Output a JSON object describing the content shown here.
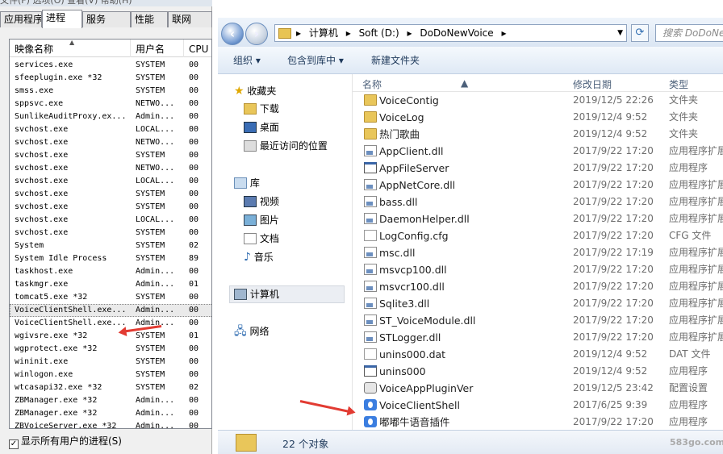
{
  "task_manager": {
    "tabs": [
      "应用程序",
      "进程",
      "服务",
      "性能",
      "联网"
    ],
    "columns": [
      "映像名称",
      "用户名",
      "CPU"
    ],
    "rows": [
      {
        "name": "services.exe",
        "user": "SYSTEM",
        "cpu": "00"
      },
      {
        "name": "sfeeplugin.exe *32",
        "user": "SYSTEM",
        "cpu": "00"
      },
      {
        "name": "smss.exe",
        "user": "SYSTEM",
        "cpu": "00"
      },
      {
        "name": "sppsvc.exe",
        "user": "NETWO...",
        "cpu": "00"
      },
      {
        "name": "SunlikeAuditProxy.ex...",
        "user": "Admin...",
        "cpu": "00"
      },
      {
        "name": "svchost.exe",
        "user": "LOCAL...",
        "cpu": "00"
      },
      {
        "name": "svchost.exe",
        "user": "NETWO...",
        "cpu": "00"
      },
      {
        "name": "svchost.exe",
        "user": "SYSTEM",
        "cpu": "00"
      },
      {
        "name": "svchost.exe",
        "user": "NETWO...",
        "cpu": "00"
      },
      {
        "name": "svchost.exe",
        "user": "LOCAL...",
        "cpu": "00"
      },
      {
        "name": "svchost.exe",
        "user": "SYSTEM",
        "cpu": "00"
      },
      {
        "name": "svchost.exe",
        "user": "SYSTEM",
        "cpu": "00"
      },
      {
        "name": "svchost.exe",
        "user": "LOCAL...",
        "cpu": "00"
      },
      {
        "name": "svchost.exe",
        "user": "SYSTEM",
        "cpu": "00"
      },
      {
        "name": "System",
        "user": "SYSTEM",
        "cpu": "02"
      },
      {
        "name": "System Idle Process",
        "user": "SYSTEM",
        "cpu": "89"
      },
      {
        "name": "taskhost.exe",
        "user": "Admin...",
        "cpu": "00"
      },
      {
        "name": "taskmgr.exe",
        "user": "Admin...",
        "cpu": "01"
      },
      {
        "name": "tomcat5.exe *32",
        "user": "SYSTEM",
        "cpu": "00"
      },
      {
        "name": "VoiceClientShell.exe...",
        "user": "Admin...",
        "cpu": "00"
      },
      {
        "name": "VoiceClientShell.exe...",
        "user": "Admin...",
        "cpu": "00"
      },
      {
        "name": "wgivsre.exe *32",
        "user": "SYSTEM",
        "cpu": "01"
      },
      {
        "name": "wgprotect.exe *32",
        "user": "SYSTEM",
        "cpu": "00"
      },
      {
        "name": "wininit.exe",
        "user": "SYSTEM",
        "cpu": "00"
      },
      {
        "name": "winlogon.exe",
        "user": "SYSTEM",
        "cpu": "00"
      },
      {
        "name": "wtcasapi32.exe *32",
        "user": "SYSTEM",
        "cpu": "02"
      },
      {
        "name": "ZBManager.exe *32",
        "user": "Admin...",
        "cpu": "00"
      },
      {
        "name": "ZBManager.exe *32",
        "user": "Admin...",
        "cpu": "00"
      },
      {
        "name": "ZBVoiceServer.exe *32",
        "user": "Admin...",
        "cpu": "00"
      }
    ],
    "show_all_label": "显示所有用户的进程(S)",
    "show_all_checked": true,
    "top_strip_text": "文件(F)  选项(O)  查看(V)  帮助(H)"
  },
  "explorer": {
    "breadcrumbs": [
      "计算机",
      "Soft (D:)",
      "DoDoNewVoice"
    ],
    "search_placeholder": "搜索 DoDoNewVoice",
    "toolbar": {
      "organize": "组织 ▾",
      "include": "包含到库中 ▾",
      "new_folder": "新建文件夹"
    },
    "tree": {
      "favorites": "收藏夹",
      "downloads": "下载",
      "desktop": "桌面",
      "recent": "最近访问的位置",
      "libraries": "库",
      "videos": "视频",
      "pictures": "图片",
      "documents": "文档",
      "music": "音乐",
      "computer": "计算机",
      "network": "网络"
    },
    "columns": [
      "名称",
      "修改日期",
      "类型"
    ],
    "files": [
      {
        "name": "VoiceContig",
        "date": "2019/12/5 22:26",
        "type": "文件夹",
        "icon": "folder-icon"
      },
      {
        "name": "VoiceLog",
        "date": "2019/12/4 9:52",
        "type": "文件夹",
        "icon": "folder-icon"
      },
      {
        "name": "热门歌曲",
        "date": "2019/12/4 9:52",
        "type": "文件夹",
        "icon": "folder-icon"
      },
      {
        "name": "AppClient.dll",
        "date": "2017/9/22 17:20",
        "type": "应用程序扩展",
        "icon": "dll-icon"
      },
      {
        "name": "AppFileServer",
        "date": "2017/9/22 17:20",
        "type": "应用程序",
        "icon": "app-icon"
      },
      {
        "name": "AppNetCore.dll",
        "date": "2017/9/22 17:20",
        "type": "应用程序扩展",
        "icon": "dll-icon"
      },
      {
        "name": "bass.dll",
        "date": "2017/9/22 17:20",
        "type": "应用程序扩展",
        "icon": "dll-icon"
      },
      {
        "name": "DaemonHelper.dll",
        "date": "2017/9/22 17:20",
        "type": "应用程序扩展",
        "icon": "dll-icon"
      },
      {
        "name": "LogConfig.cfg",
        "date": "2017/9/22 17:20",
        "type": "CFG 文件",
        "icon": "text-file-icon"
      },
      {
        "name": "msc.dll",
        "date": "2017/9/22 17:19",
        "type": "应用程序扩展",
        "icon": "dll-icon"
      },
      {
        "name": "msvcp100.dll",
        "date": "2017/9/22 17:20",
        "type": "应用程序扩展",
        "icon": "dll-icon"
      },
      {
        "name": "msvcr100.dll",
        "date": "2017/9/22 17:20",
        "type": "应用程序扩展",
        "icon": "dll-icon"
      },
      {
        "name": "Sqlite3.dll",
        "date": "2017/9/22 17:20",
        "type": "应用程序扩展",
        "icon": "dll-icon"
      },
      {
        "name": "ST_VoiceModule.dll",
        "date": "2017/9/22 17:20",
        "type": "应用程序扩展",
        "icon": "dll-icon"
      },
      {
        "name": "STLogger.dll",
        "date": "2017/9/22 17:20",
        "type": "应用程序扩展",
        "icon": "dll-icon"
      },
      {
        "name": "unins000.dat",
        "date": "2019/12/4 9:52",
        "type": "DAT 文件",
        "icon": "text-file-icon"
      },
      {
        "name": "unins000",
        "date": "2019/12/4 9:52",
        "type": "应用程序",
        "icon": "app-icon"
      },
      {
        "name": "VoiceAppPluginVer",
        "date": "2019/12/5 23:42",
        "type": "配置设置",
        "icon": "settings-file-icon"
      },
      {
        "name": "VoiceClientShell",
        "date": "2017/6/25 9:39",
        "type": "应用程序",
        "icon": "voice-app-icon"
      },
      {
        "name": "嘟嘟牛语音插件",
        "date": "2017/9/22 17:20",
        "type": "应用程序",
        "icon": "voice-app-icon"
      }
    ],
    "status_text": "22 个对象",
    "watermark": "583go.com"
  },
  "colors": {
    "accent": "#3b7ee0",
    "arrow": "#e23b32",
    "folder": "#e9c65a"
  }
}
